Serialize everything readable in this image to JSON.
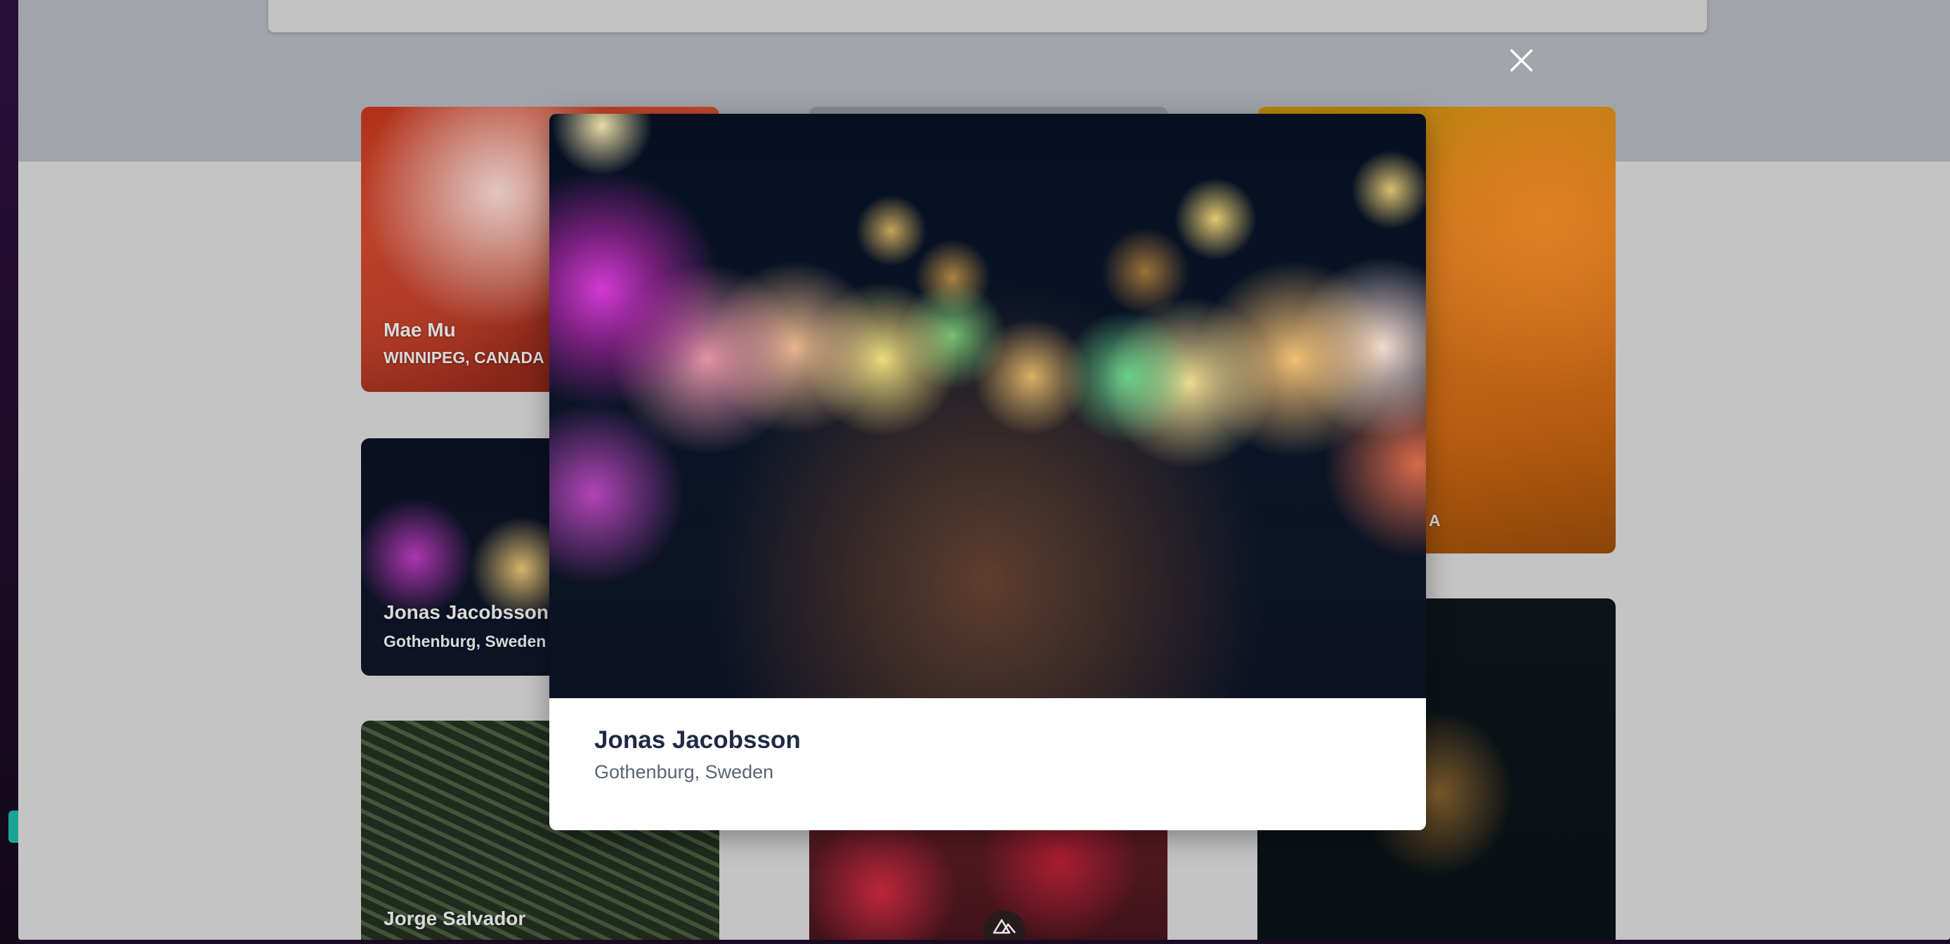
{
  "gallery": {
    "cards": [
      {
        "name": "Mae Mu",
        "location": "WINNIPEG, CANADA"
      },
      {
        "name": "Jonas Jacobsson",
        "location": "Gothenburg, Sweden"
      },
      {
        "name": "Jorge Salvador",
        "location": ""
      },
      {
        "name": "",
        "location": ""
      },
      {
        "name": "",
        "location": ""
      },
      {
        "name": "",
        "location": "A"
      },
      {
        "name": "",
        "location": ""
      },
      {
        "name": "",
        "location": ""
      }
    ]
  },
  "modal": {
    "title": "Jonas Jacobsson",
    "subtitle": "Gothenburg, Sweden"
  },
  "icons": {
    "close": "close-icon",
    "logo": "mountain-logo-icon"
  },
  "colors": {
    "modal_title": "#1f2a44",
    "modal_subtitle": "#5a6476",
    "hero_band": "#a2a4a9",
    "page_bg": "#c4c4c4"
  }
}
